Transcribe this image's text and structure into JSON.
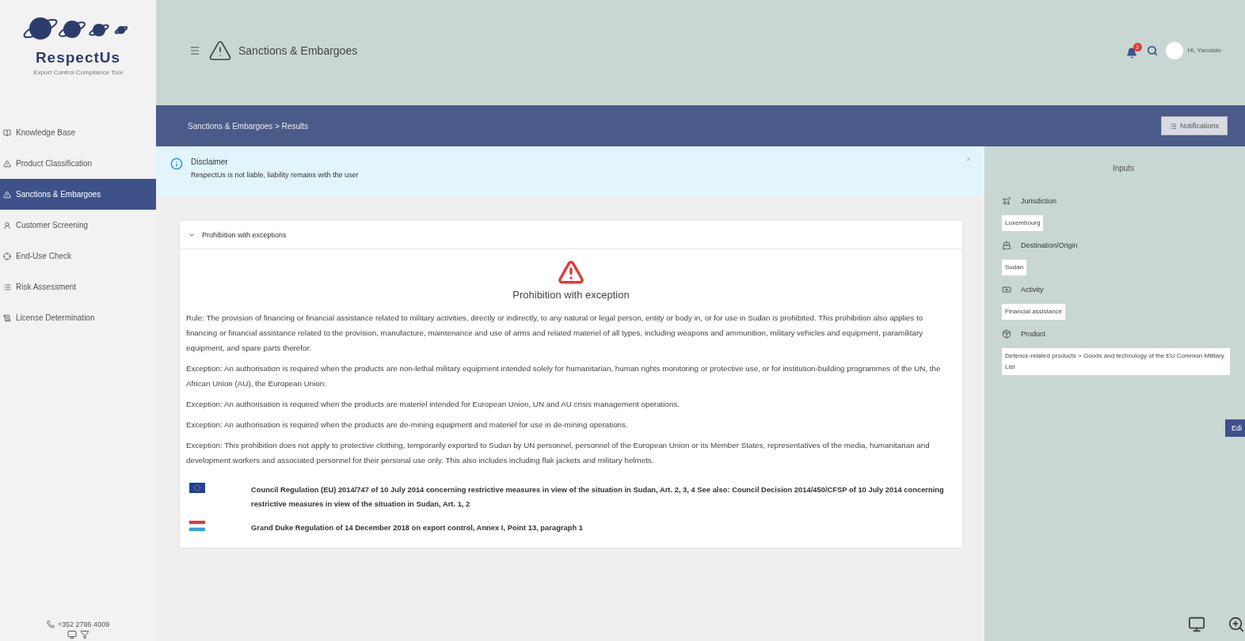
{
  "brand": {
    "name": "RespectUs",
    "tagline": "Export Control Compliance Tool"
  },
  "sidebar": {
    "items": [
      {
        "label": "Knowledge Base",
        "selected": false
      },
      {
        "label": "Product Classification",
        "selected": false
      },
      {
        "label": "Sanctions & Embargoes",
        "selected": true
      },
      {
        "label": "Customer Screening",
        "selected": false
      },
      {
        "label": "End-Use Check",
        "selected": false
      },
      {
        "label": "Risk Assessment",
        "selected": false
      },
      {
        "label": "License Determination",
        "selected": false
      }
    ],
    "phone": "+352 2786 4009"
  },
  "header": {
    "title": "Sanctions & Embargoes",
    "notification_count": "2",
    "greeting": "Hi, Yaroslav"
  },
  "breadcrumb": "Sanctions & Embargoes > Results",
  "notifications_button": "Notifications",
  "disclaimer": {
    "title": "Disclaimer",
    "text": "RespectUs is not liable, liability remains with the user"
  },
  "result": {
    "section": "Prohibition with exceptions",
    "expanded": true,
    "heading": "Prohibition with exception",
    "paragraphs": [
      "Rule: The provision of financing or financial assistance related to military activities, directly or indirectly, to any natural or legal person, entity or body in, or for use in Sudan is prohibited. This prohibition also applies to financing or financial assistance related to the provision, manufacture, maintenance and use of arms and related materiel of all types, including weapons and ammunition, military vehicles and equipment, paramilitary equipment, and spare parts therefor.",
      "Exception: An authorisation is required when the products are non-lethal military equipment intended solely for humanitarian, human rights monitoring or protective use, or for institution-building programmes of the UN, the African Union (AU), the European Union.",
      "Exception: An authorisation is required when the products are materiel intended for European Union, UN and AU crisis management operations.",
      "Exception: An authorisation is required when the products are de-mining equipment and materiel for use in de-mining operations.",
      "Exception: This prohibition does not apply to protective clothing, temporarily exported to Sudan by UN personnel, personnel of the European Union or its Member States, representatives of the media, humanitarian and development workers and associated personnel for their personal use only. This also includes including flak jackets and military helmets."
    ],
    "references": [
      {
        "kind": "eu",
        "text": "Council Regulation (EU) 2014/747 of 10 July 2014 concerning restrictive measures in view of the situation in Sudan, Art. 2, 3, 4 See also: Council Decision 2014/450/CFSP of 10 July 2014 concerning restrictive measures in view of the situation in Sudan, Art. 1, 2"
      },
      {
        "kind": "lu",
        "text": "Grand Duke Regulation of 14 December 2018 on export control, Annex I, Point 13, paragraph 1"
      }
    ]
  },
  "inputs": {
    "title": "Inputs",
    "fields": [
      {
        "label": "Jurisdiction",
        "value": "Luxembourg"
      },
      {
        "label": "Destination/Origin",
        "value": "Sudan"
      },
      {
        "label": "Activity",
        "value": "Financial assistance"
      },
      {
        "label": "Product",
        "value": "Defence-related products > Goods and technology of the EU Common Military List"
      }
    ],
    "edit_button": "Edi"
  }
}
